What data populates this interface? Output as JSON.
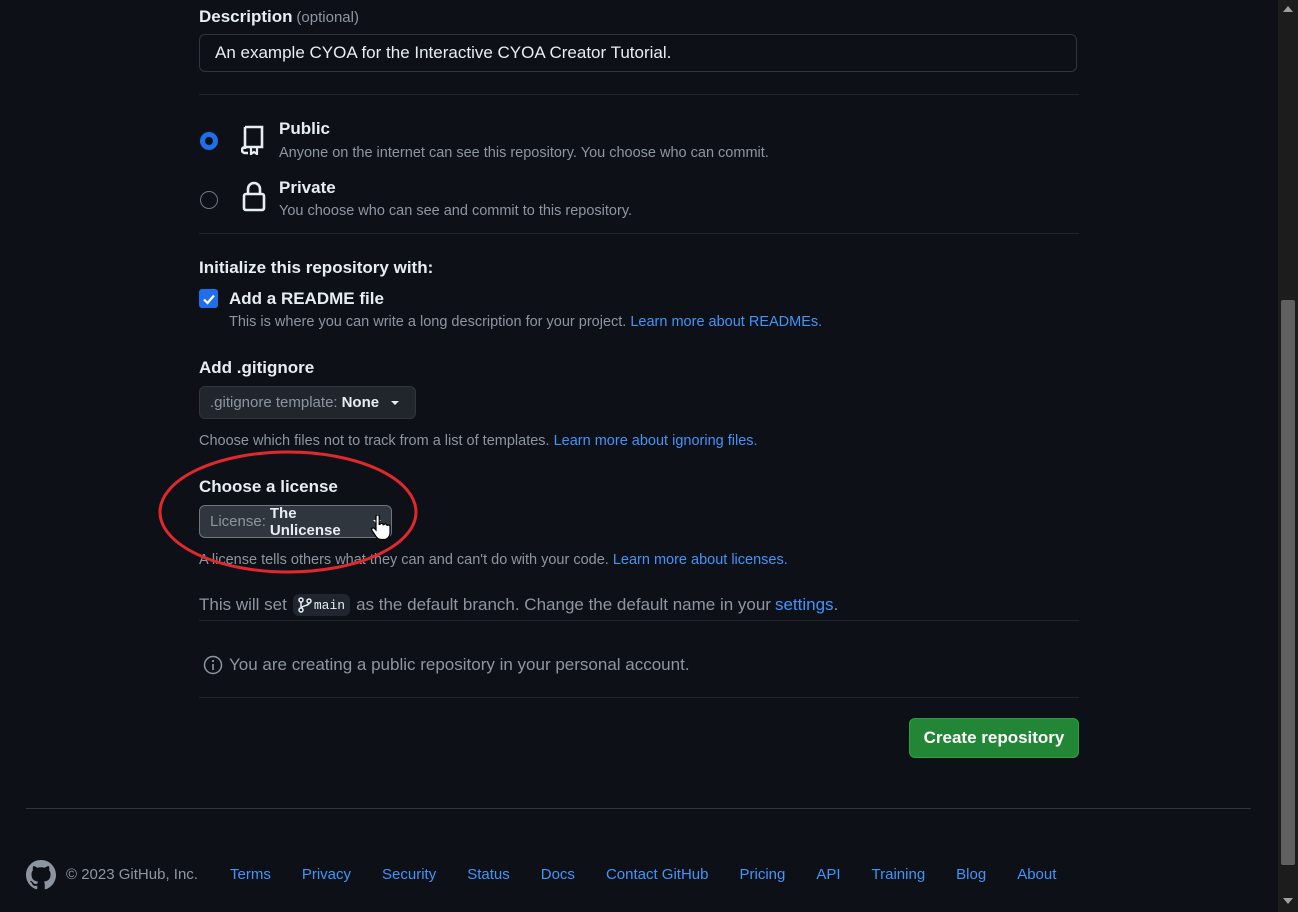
{
  "description": {
    "label": "Description",
    "optional": "(optional)",
    "value": "An example CYOA for the Interactive CYOA Creator Tutorial."
  },
  "visibility": {
    "public_title": "Public",
    "public_desc": "Anyone on the internet can see this repository. You choose who can commit.",
    "private_title": "Private",
    "private_desc": "You choose who can see and commit to this repository."
  },
  "init": {
    "heading": "Initialize this repository with:",
    "readme_label": "Add a README file",
    "readme_desc": "This is where you can write a long description for your project.",
    "readme_link": "Learn more about READMEs."
  },
  "gitignore": {
    "heading": "Add .gitignore",
    "prefix": ".gitignore template:",
    "value": "None",
    "desc": "Choose which files not to track from a list of templates.",
    "link": "Learn more about ignoring files."
  },
  "license": {
    "heading": "Choose a license",
    "prefix": "License:",
    "value": "The Unlicense",
    "desc": "A license tells others what they can and can't do with your code.",
    "link": "Learn more about licenses."
  },
  "branch": {
    "prefix": "This will set",
    "branch_name": "main",
    "middle": "as the default branch. Change the default name in your",
    "link": "settings",
    "suffix": "."
  },
  "notice": "You are creating a public repository in your personal account.",
  "create_button": "Create repository",
  "footer": {
    "copyright": "© 2023 GitHub, Inc.",
    "links": [
      "Terms",
      "Privacy",
      "Security",
      "Status",
      "Docs",
      "Contact GitHub",
      "Pricing",
      "API",
      "Training",
      "Blog",
      "About"
    ]
  },
  "colors": {
    "accent": "#1f6feb",
    "link": "#4493f8",
    "primary_button": "#238636",
    "annotation_circle": "#e0282e"
  }
}
